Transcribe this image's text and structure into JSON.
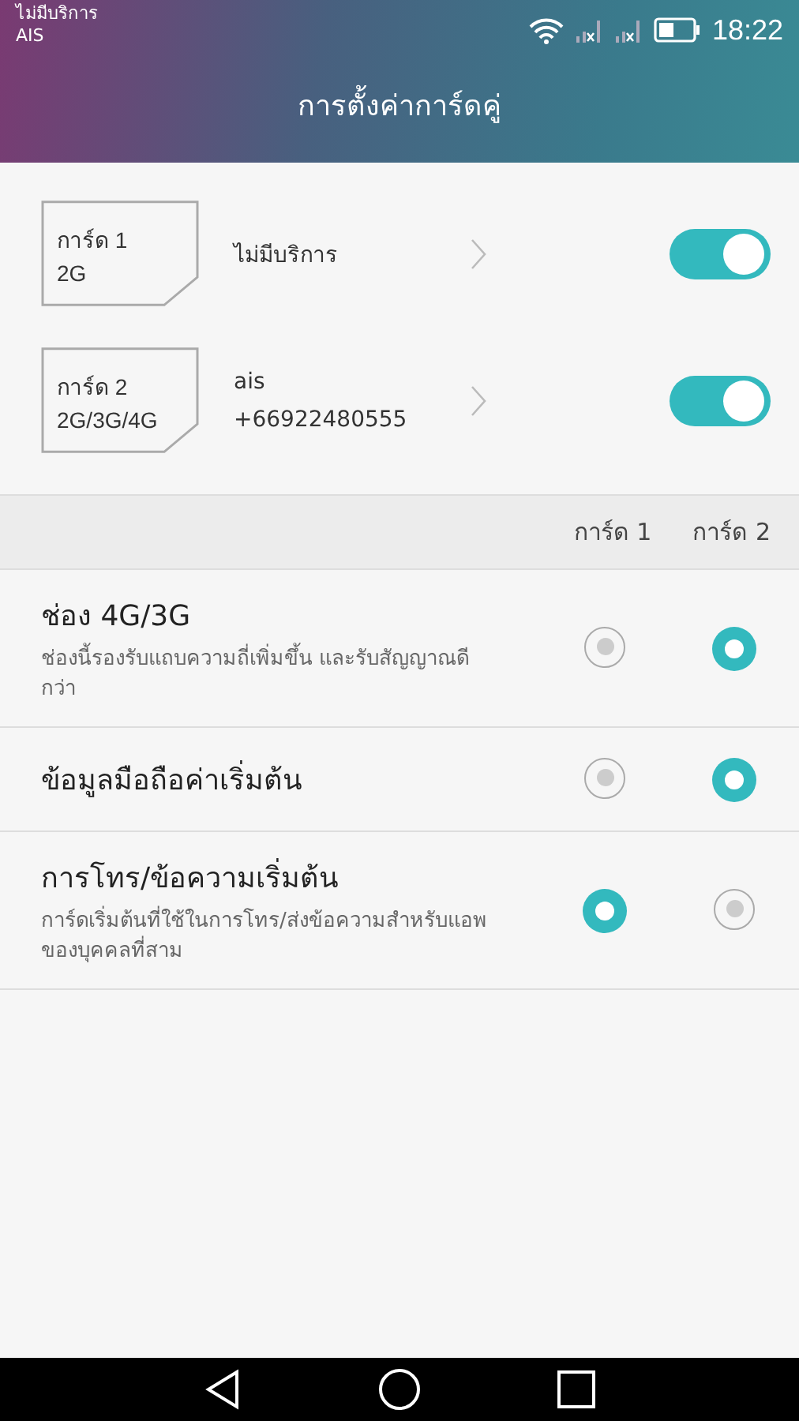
{
  "status_bar": {
    "carrier_status": "ไม่มีบริการ",
    "carrier": "AIS",
    "time": "18:22"
  },
  "title": "การตั้งค่าการ์ดคู่",
  "sims": [
    {
      "card_label": "การ์ด 1",
      "card_network": "2G",
      "lines": [
        "ไม่มีบริการ"
      ],
      "on": true
    },
    {
      "card_label": "การ์ด 2",
      "card_network": "2G/3G/4G",
      "lines": [
        "ais",
        "+66922480555"
      ],
      "on": true
    }
  ],
  "columns": [
    "การ์ด 1",
    "การ์ด 2"
  ],
  "settings": [
    {
      "title": "ช่อง 4G/3G",
      "description": "ช่องนี้รองรับแถบความถี่เพิ่มขึ้น และรับสัญญาณดีกว่า",
      "choices": [
        {
          "selected": false
        },
        {
          "selected": true
        }
      ]
    },
    {
      "title": "ข้อมูลมือถือค่าเริ่มต้น",
      "choices": [
        {
          "selected": false
        },
        {
          "selected": true
        }
      ]
    },
    {
      "title": "การโทร/ข้อความเริ่มต้น",
      "description": "การ์ดเริ่มต้นที่ใช้ในการโทร/ส่งข้อความสำหรับแอพของบุคคลที่สาม",
      "choices": [
        {
          "selected": true
        },
        {
          "selected": false
        }
      ]
    }
  ]
}
